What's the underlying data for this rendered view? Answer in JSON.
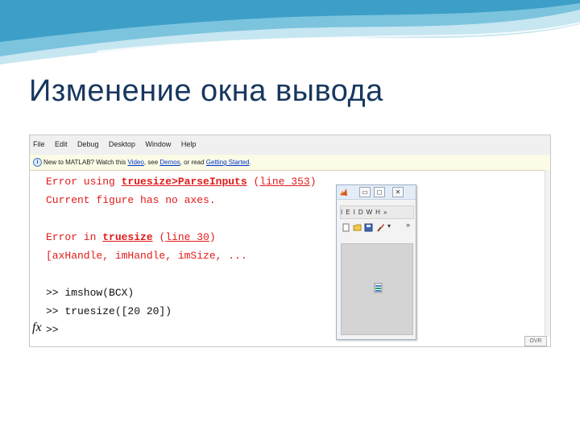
{
  "slide": {
    "title": "Изменение окна вывода"
  },
  "matlab": {
    "menu": [
      "File",
      "Edit",
      "Debug",
      "Desktop",
      "Window",
      "Help"
    ],
    "infobar": {
      "prefix": "New to MATLAB? Watch this ",
      "video_link": "Video",
      "middle": ", see ",
      "demos_link": "Demos",
      "middle2": ", or read ",
      "getting_started_link": "Getting Started",
      "suffix": "."
    },
    "command_window": {
      "line1": {
        "prefix": "Error using ",
        "link": "truesize>ParseInputs",
        "suffix": " (",
        "line_link": "line 353",
        "close": ")"
      },
      "line2": "Current figure has no axes.",
      "line3": {
        "prefix": "Error in ",
        "link": "truesize",
        "suffix": " (",
        "line_link": "line 30",
        "close": ")"
      },
      "line4": "[axHandle, imHandle, imSize, ...",
      "cmd1": ">> imshow(BCX)",
      "cmd2": ">> truesize([20 20])",
      "prompt": ">>",
      "fx": "fx"
    },
    "status": "OVR"
  },
  "figure_window": {
    "titlebar_buttons": [
      "▭",
      "◻",
      "✕"
    ],
    "menus": [
      "I",
      "E",
      "I",
      "D",
      "W",
      "H",
      "»"
    ],
    "tools_more": "»"
  },
  "colors": {
    "title": "#17375e",
    "error": "#e21a1a",
    "swoosh1": "#7cc4de",
    "swoosh2": "#c6e6f1"
  }
}
